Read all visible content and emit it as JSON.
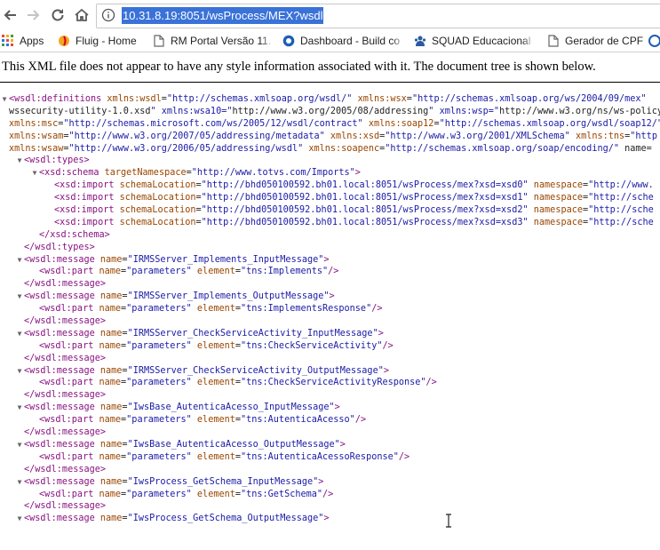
{
  "browser": {
    "url": "10.31.8.19:8051/wsProcess/MEX?wsdl"
  },
  "bookmarks": [
    {
      "icon": "apps-grid-icon",
      "label": "Apps"
    },
    {
      "icon": "fluig-icon",
      "label": "Fluig - Home"
    },
    {
      "icon": "page-icon",
      "label": "RM Portal Versão 11."
    },
    {
      "icon": "build-dashboard-icon",
      "label": "Dashboard - Build co"
    },
    {
      "icon": "squad-icon",
      "label": "SQUAD Educacional"
    },
    {
      "icon": "page-icon",
      "label": "Gerador de CPF"
    },
    {
      "icon": "globe-icon",
      "label": ""
    }
  ],
  "notice": "This XML file does not appear to have any style information associated with it. The document tree is shown below.",
  "xml_lines": [
    "<wsdl:definitions xmlns:wsdl=\"http://schemas.xmlsoap.org/wsdl/\" xmlns:wsx=\"http://schemas.xmlsoap.org/ws/2004/09/mex\"",
    "wssecurity-utility-1.0.xsd\" xmlns:wsa10=\"http://www.w3.org/2005/08/addressing\" xmlns:wsp=\"http://www.w3.org/ns/ws-policy\"",
    "xmlns:msc=\"http://schemas.microsoft.com/ws/2005/12/wsdl/contract\" xmlns:soap12=\"http://schemas.xmlsoap.org/wsdl/soap12/\"",
    "xmlns:wsam=\"http://www.w3.org/2007/05/addressing/metadata\" xmlns:xsd=\"http://www.w3.org/2001/XMLSchema\" xmlns:tns=\"http",
    "xmlns:wsaw=\"http://www.w3.org/2006/05/addressing/wsdl\" xmlns:soapenc=\"http://schemas.xmlsoap.org/soap/encoding/\" name=",
    "<wsdl:types>",
    "<xsd:schema targetNamespace=\"http://www.totvs.com/Imports\">",
    "<xsd:import schemaLocation=\"http://bhd050100592.bh01.local:8051/wsProcess/mex?xsd=xsd0\" namespace=\"http://www.",
    "<xsd:import schemaLocation=\"http://bhd050100592.bh01.local:8051/wsProcess/mex?xsd=xsd1\" namespace=\"http://sche",
    "<xsd:import schemaLocation=\"http://bhd050100592.bh01.local:8051/wsProcess/mex?xsd=xsd2\" namespace=\"http://sche",
    "<xsd:import schemaLocation=\"http://bhd050100592.bh01.local:8051/wsProcess/mex?xsd=xsd3\" namespace=\"http://sche",
    "</xsd:schema>",
    "</wsdl:types>",
    "<wsdl:message name=\"IRMSServer_Implements_InputMessage\">",
    "<wsdl:part name=\"parameters\" element=\"tns:Implements\"/>",
    "</wsdl:message>",
    "<wsdl:message name=\"IRMSServer_Implements_OutputMessage\">",
    "<wsdl:part name=\"parameters\" element=\"tns:ImplementsResponse\"/>",
    "</wsdl:message>",
    "<wsdl:message name=\"IRMSServer_CheckServiceActivity_InputMessage\">",
    "<wsdl:part name=\"parameters\" element=\"tns:CheckServiceActivity\"/>",
    "</wsdl:message>",
    "<wsdl:message name=\"IRMSServer_CheckServiceActivity_OutputMessage\">",
    "<wsdl:part name=\"parameters\" element=\"tns:CheckServiceActivityResponse\"/>",
    "</wsdl:message>",
    "<wsdl:message name=\"IwsBase_AutenticaAcesso_InputMessage\">",
    "<wsdl:part name=\"parameters\" element=\"tns:AutenticaAcesso\"/>",
    "</wsdl:message>",
    "<wsdl:message name=\"IwsBase_AutenticaAcesso_OutputMessage\">",
    "<wsdl:part name=\"parameters\" element=\"tns:AutenticaAcessoResponse\"/>",
    "</wsdl:message>",
    "<wsdl:message name=\"IwsProcess_GetSchema_InputMessage\">",
    "<wsdl:part name=\"parameters\" element=\"tns:GetSchema\"/>",
    "</wsdl:message>",
    "<wsdl:message name=\"IwsProcess_GetSchema_OutputMessage\">"
  ]
}
